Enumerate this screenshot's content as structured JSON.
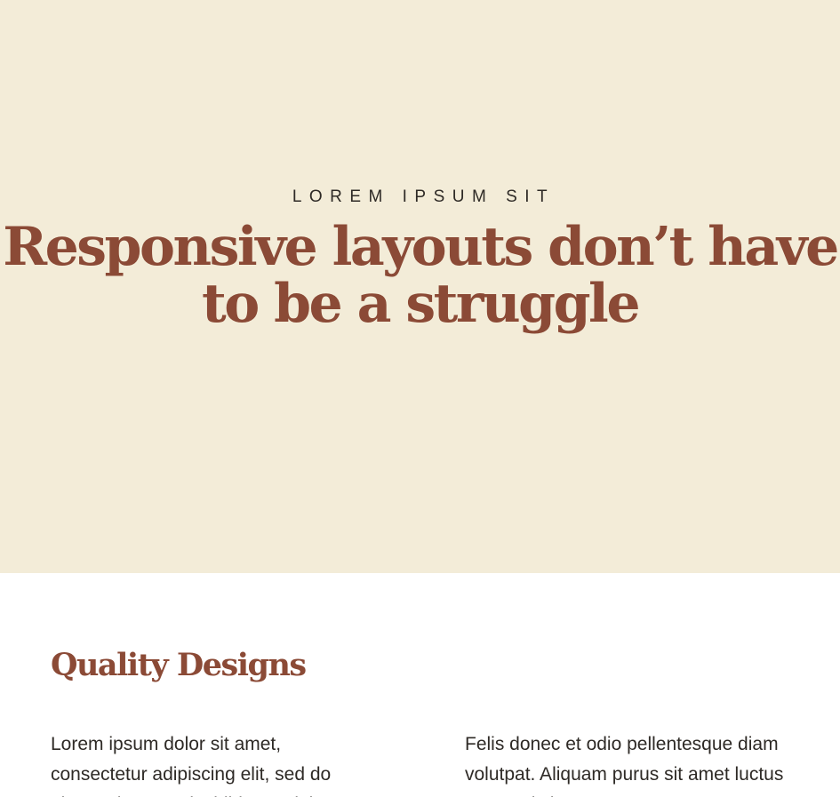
{
  "hero": {
    "eyebrow": "LOREM IPSUM SIT",
    "headline": "Responsive layouts don’t have to be a struggle"
  },
  "features": {
    "title": "Quality Designs",
    "left_paragraph": "Lorem ipsum dolor sit amet, consectetur adipiscing elit, sed do eiusmod tempor incididunt ut labore",
    "right_paragraph": "Felis donec et odio pellentesque diam volutpat. Aliquam purus sit amet luctus venenatis lectus magna"
  },
  "colors": {
    "hero_background": "#f3ecd8",
    "accent": "#8b4a36",
    "body_text": "#2e2a26",
    "content_background": "#ffffff"
  }
}
